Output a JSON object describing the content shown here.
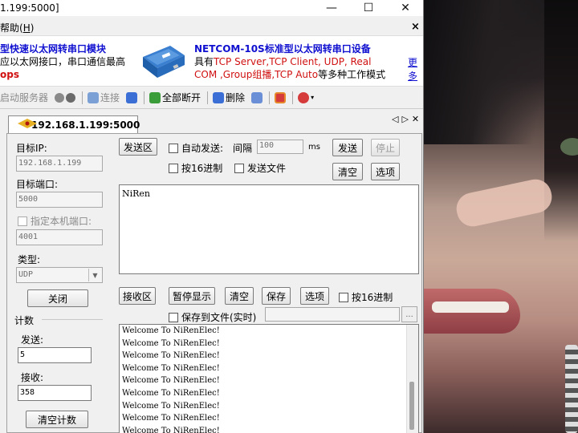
{
  "window": {
    "title": "1.199:5000]",
    "minimize_glyph": "—",
    "maximize_glyph": "☐",
    "close_glyph": "✕"
  },
  "menu": {
    "help_prefix": "帮助(",
    "help_key": "H",
    "help_suffix": ")",
    "close_glyph": "×"
  },
  "banner": {
    "left_line1": "型快速以太网转串口模块",
    "left_line2": "应以太网接口，串口通信最高",
    "left_line3": "ops",
    "right_line1": "NETCOM-10S标准型以太网转串口设备",
    "right_line2_a": "具有",
    "right_line2_b": "TCP Server,TCP Client, UDP, Real",
    "right_line3_a": "COM ,Group组播,TCP Auto",
    "right_line3_b": "等多种工作模式",
    "more_link": "更多"
  },
  "toolbar": {
    "start_server": "启动服务器",
    "connect": "连接",
    "disconnect_all": "全部断开",
    "delete": "删除",
    "colors": {
      "green": "#3a9d3a",
      "blue": "#3b6fd6",
      "red": "#d63b3b",
      "orange": "#e6892a"
    }
  },
  "tab": {
    "label": "192.168.1.199:5000",
    "controls": "◁▷✕"
  },
  "left": {
    "target_ip_label": "目标IP:",
    "target_ip_value": "192.168.1.199",
    "target_port_label": "目标端口:",
    "target_port_value": "5000",
    "specify_local_port_label": "指定本机端口:",
    "local_port_value": "4001",
    "type_label": "类型:",
    "type_value": "UDP",
    "close_button": "关闭",
    "counter_group": "计数",
    "sent_label": "发送:",
    "sent_value": "5",
    "received_label": "接收:",
    "received_value": "358",
    "clear_counter_button": "清空计数"
  },
  "send": {
    "section_button": "发送区",
    "auto_send": "自动发送:",
    "interval_label": "间隔",
    "interval_value": "100",
    "interval_unit": "ms",
    "send_button": "发送",
    "stop_button": "停止",
    "hex_send": "按16进制",
    "send_file": "发送文件",
    "clear_button": "清空",
    "options_button": "选项",
    "text": "NiRen"
  },
  "receive": {
    "section_button": "接收区",
    "pause_button": "暂停显示",
    "clear_button": "清空",
    "save_button": "保存",
    "options_button": "选项",
    "hex_display": "按16进制",
    "save_to_file": "保存到文件(实时)",
    "browse_glyph": "...",
    "lines": [
      "Welcome To NiRenElec!",
      "Welcome To NiRenElec!",
      "Welcome To NiRenElec!",
      "Welcome To NiRenElec!",
      "Welcome To NiRenElec!",
      "Welcome To NiRenElec!",
      "Welcome To NiRenElec!",
      "Welcome To NiRenElec!",
      "Welcome To NiRenElec!"
    ]
  }
}
